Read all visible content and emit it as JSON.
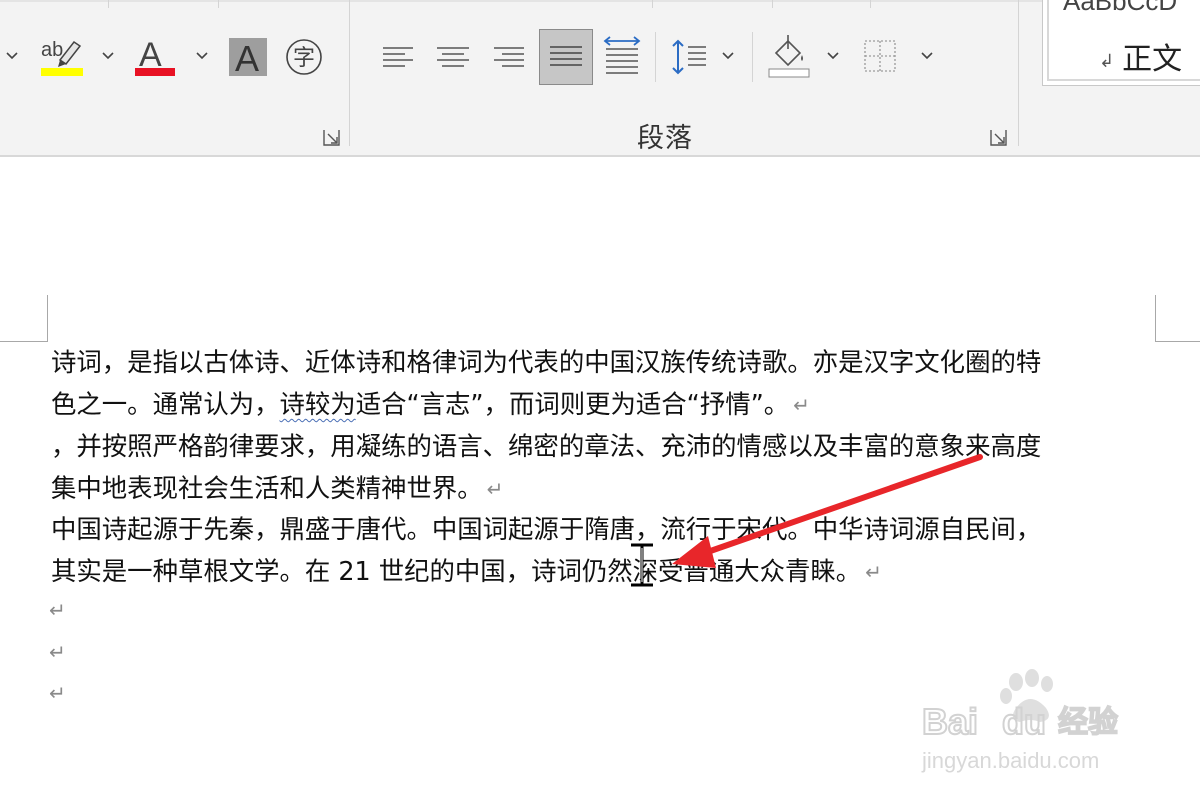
{
  "ribbon": {
    "font_group": {
      "highlight_label": "ab",
      "highlight_color": "#ffff00",
      "font_color_label": "A",
      "font_color": "#e81123",
      "shading_label": "A",
      "phonetic_label": "字"
    },
    "paragraph_group": {
      "label": "段落"
    },
    "styles_gallery": {
      "sample_text": "AaBbCcD",
      "current_style": "正文",
      "mark": "↲"
    }
  },
  "document": {
    "paragraphs": [
      {
        "line1": "诗词，是指以古体诗、近体诗和格律词为代表的中国汉族传统诗歌。亦是汉字文化圈的特",
        "line2_pre": "色之一。通常认为，",
        "line2_flagged": "诗较为",
        "line2_post": "适合“言志”，而词则更为适合“抒情”。"
      },
      {
        "line1": "，并按照严格韵律要求，用凝练的语言、绵密的章法、充沛的情感以及丰富的意象来高度",
        "line2": "集中地表现社会生活和人类精神世界。"
      },
      {
        "line1": "中国诗起源于先秦，鼎盛于唐代。中国词起源于隋唐，流行于宋代。中华诗词源自民间，",
        "line2": "其实是一种草根文学。在 21 世纪的中国，诗词仍然深受普通大众青睐。"
      }
    ],
    "paragraph_mark": "↵",
    "empty_paragraph_count": 3
  },
  "annotation": {
    "arrow_color": "#e8262a"
  },
  "watermark": {
    "brand": "Bai du 经验",
    "url": "jingyan.baidu.com"
  }
}
